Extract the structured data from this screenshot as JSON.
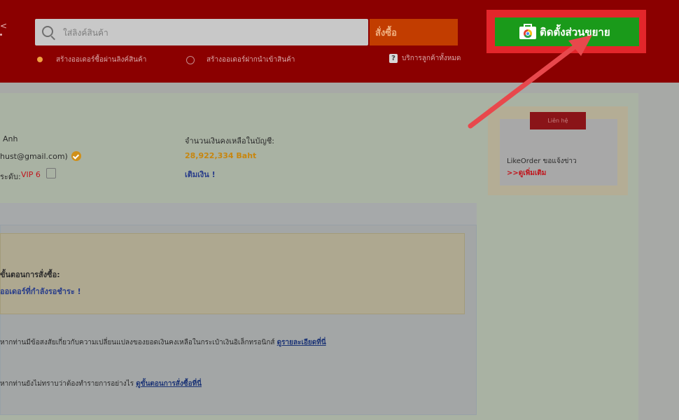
{
  "header": {
    "logo_fragment": "<",
    "search": {
      "placeholder": "ใส่ลิงค์สินค้า"
    },
    "order_button": "สั่งซื้อ",
    "radio_options": [
      "สร้างออเดอร์ซื้อผ่านลิงค์สินค้า",
      "สร้างออเดอร์ฝากนำเข้าสินค้า"
    ],
    "help_icon": "?",
    "help_link": "บริการลูกค้าทั้งหมด",
    "install_extension_button": "ติดตั้งส่วนขยาย",
    "install_icon": "chrome-web-store-icon"
  },
  "account": {
    "name_fragment": "Anh",
    "email_fragment": "hust@gmail.com)",
    "level_label": "ระดับ:",
    "level_value": "VIP 6",
    "balance_label": "จำนวนเงินคงเหลือในบัญชี:",
    "balance_value": "28,922,334 Baht",
    "topup_link": "เติมเงิน !"
  },
  "side_card": {
    "button": "Liên hệ",
    "title": "LikeOrder ขอแจ้งข่าว",
    "link": ">>ดูเพิ่มเติม"
  },
  "notice": {
    "line1": "ขั้นตอนการสั่งซื้อ:",
    "line2": "ออเดอร์ที่กำลังรอชำระ !"
  },
  "info_lines": [
    {
      "text": "หากท่านมีข้อสงสัยเกี่ยวกับความเปลี่ยนแปลงของยอดเงินคงเหลือในกระเป๋าเงินอิเล็กทรอนิกส์",
      "link": "ดูรายละเอียดที่นี่"
    },
    {
      "text": "หากท่านยังไม่ทราบว่าต้องทำรายการอย่างไร",
      "link": "ดูขั้นตอนการสั่งซื้อที่นี่"
    }
  ],
  "colors": {
    "header_bg": "#8b0000",
    "highlight": "#e3262b",
    "install_green": "#1a9a1a",
    "arrow": "#e8484c"
  }
}
